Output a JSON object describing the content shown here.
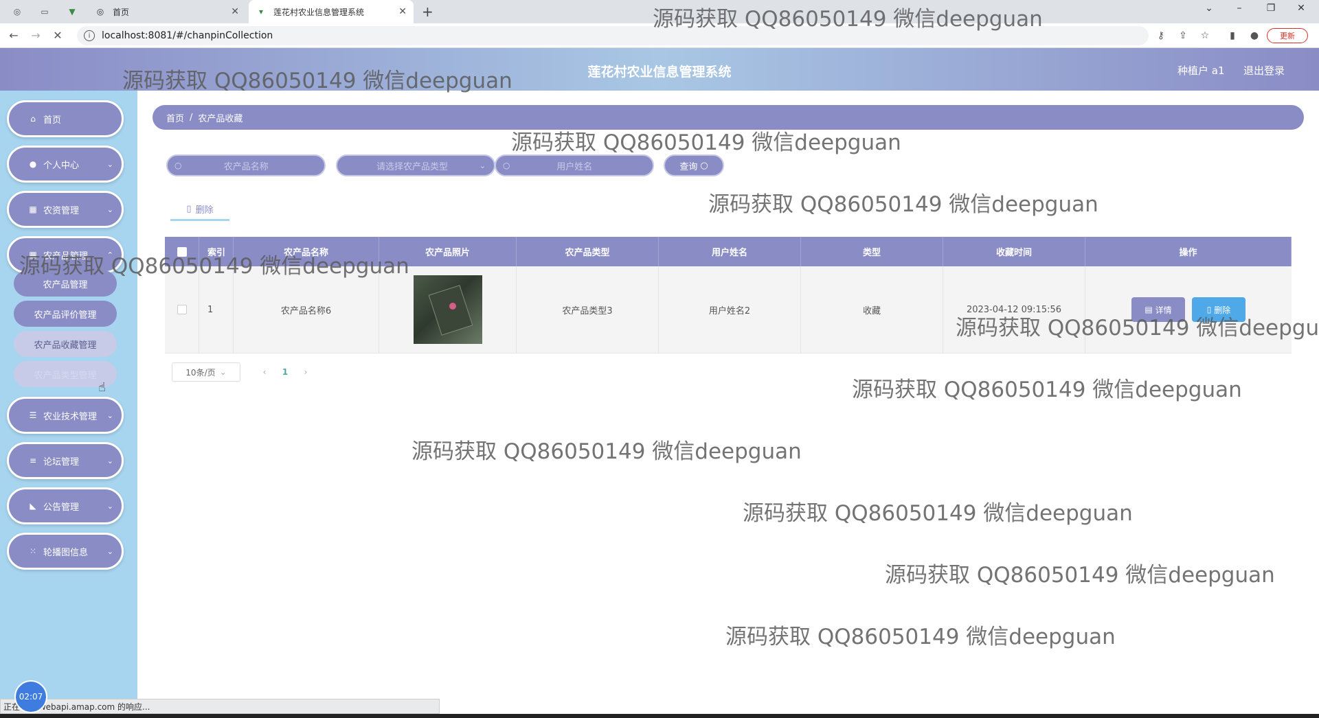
{
  "browser": {
    "tabs": [
      {
        "title": "首页",
        "active": false
      },
      {
        "title": "莲花村农业信息管理系统",
        "active": true
      }
    ],
    "url": "localhost:8081/#/chanpinCollection",
    "update_label": "更新"
  },
  "header": {
    "title": "莲花村农业信息管理系统",
    "user": "种植户 a1",
    "logout": "退出登录"
  },
  "sidebar": {
    "items": [
      {
        "label": "首页",
        "icon": "home-icon"
      },
      {
        "label": "个人中心",
        "icon": "user-icon"
      },
      {
        "label": "农资管理",
        "icon": "grid-icon"
      },
      {
        "label": "农产品管理",
        "icon": "grid-icon"
      },
      {
        "label": "农业技术管理",
        "icon": "sliders-icon"
      },
      {
        "label": "论坛管理",
        "icon": "list-icon"
      },
      {
        "label": "公告管理",
        "icon": "megaphone-icon"
      },
      {
        "label": "轮播图信息",
        "icon": "apps-icon"
      }
    ],
    "submenu": [
      "农产品管理",
      "农产品评价管理",
      "农产品收藏管理",
      "农产品类型管理"
    ]
  },
  "breadcrumb": {
    "home": "首页",
    "current": "农产品收藏"
  },
  "filters": {
    "name_placeholder": "农产品名称",
    "type_placeholder": "请选择农产品类型",
    "user_placeholder": "用户姓名",
    "query_label": "查询"
  },
  "toolbar": {
    "delete_label": "删除"
  },
  "table": {
    "headers": [
      "索引",
      "农产品名称",
      "农产品照片",
      "农产品类型",
      "用户姓名",
      "类型",
      "收藏时间",
      "操作"
    ],
    "rows": [
      {
        "index": "1",
        "name": "农产品名称6",
        "type": "农产品类型3",
        "user": "用户姓名2",
        "kind": "收藏",
        "time": "2023-04-12 09:15:56"
      }
    ],
    "detail_label": "详情",
    "delete_label": "删除"
  },
  "pager": {
    "page_size": "10条/页",
    "current_page": "1"
  },
  "status": {
    "text": "正在等待 webapi.amap.com 的响应...",
    "timer": "02:07"
  },
  "watermark": "源码获取 QQ86050149 微信deepguan",
  "colors": {
    "primary": "#8a8cc6",
    "sidebar": "#a7d4ee",
    "delete": "#4fa9e8"
  }
}
